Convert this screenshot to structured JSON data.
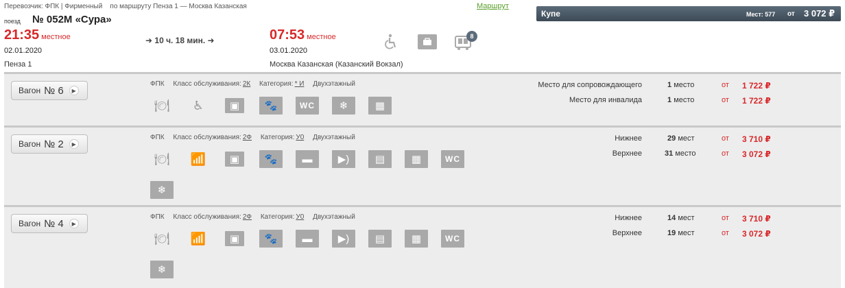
{
  "header": {
    "carrier": "Перевозчик: ФПК | Фирменный",
    "route_desc": "по маршруту Пенза 1 — Москва Казанская",
    "route_link": "Маршрут",
    "train_label": "поезд",
    "train_name": "№ 052М «Сура»",
    "departure": {
      "time": "21:35",
      "time_note": "местное",
      "date": "02.01.2020",
      "station": "Пенза 1"
    },
    "duration": "➜ 10 ч. 18 мин. ➜",
    "arrival": {
      "time": "07:53",
      "time_note": "местное",
      "date": "03.01.2020",
      "station": "Москва Казанская (Казанский Вокзал)"
    },
    "icons": [
      "wheelchair-icon",
      "bag-icon",
      "wagon-scheme-icon"
    ],
    "wagon_scheme_badge": "8"
  },
  "class_bar": {
    "name": "Купе",
    "seats": "Мест: 577",
    "ot": "от",
    "price": "3 072 ₽"
  },
  "wagons": [
    {
      "label": "Вагон",
      "number": "№ 6",
      "carrier": "ФПК",
      "class_label": "Класс обслуживания:",
      "class_value": "2К",
      "category_label": "Категория:",
      "category_value": "* И",
      "type": "Двухэтажный",
      "icons": [
        "food-icon",
        "wheelchair-icon",
        "bag-icon",
        "pet-icon",
        "wc-icon",
        "snowflake-icon",
        "linen-icon"
      ],
      "seats": [
        {
          "type": "Место для сопровождающего",
          "count": "1",
          "unit": "место",
          "ot": "от",
          "price": "1 722 ₽"
        },
        {
          "type": "Место для инвалида",
          "count": "1",
          "unit": "место",
          "ot": "от",
          "price": "1 722 ₽"
        }
      ]
    },
    {
      "label": "Вагон",
      "number": "№ 2",
      "carrier": "ФПК",
      "class_label": "Класс обслуживания:",
      "class_value": "2Ф",
      "category_label": "Категория:",
      "category_value": "У0",
      "type": "Двухэтажный",
      "icons": [
        "food-icon",
        "chart-icon",
        "bag-icon",
        "pet-icon",
        "toothbrush-icon",
        "audio-icon",
        "newspaper-icon",
        "linen-icon",
        "wc-icon",
        "snowflake-icon"
      ],
      "seats": [
        {
          "type": "Нижнее",
          "count": "29",
          "unit": "мест",
          "ot": "от",
          "price": "3 710 ₽"
        },
        {
          "type": "Верхнее",
          "count": "31",
          "unit": "место",
          "ot": "от",
          "price": "3 072 ₽"
        }
      ]
    },
    {
      "label": "Вагон",
      "number": "№ 4",
      "carrier": "ФПК",
      "class_label": "Класс обслуживания:",
      "class_value": "2Ф",
      "category_label": "Категория:",
      "category_value": "У0",
      "type": "Двухэтажный",
      "icons": [
        "food-icon",
        "chart-icon",
        "bag-icon",
        "pet-icon",
        "toothbrush-icon",
        "audio-icon",
        "newspaper-icon",
        "linen-icon",
        "wc-icon",
        "snowflake-icon"
      ],
      "seats": [
        {
          "type": "Нижнее",
          "count": "14",
          "unit": "мест",
          "ot": "от",
          "price": "3 710 ₽"
        },
        {
          "type": "Верхнее",
          "count": "19",
          "unit": "мест",
          "ot": "от",
          "price": "3 072 ₽"
        }
      ]
    }
  ]
}
